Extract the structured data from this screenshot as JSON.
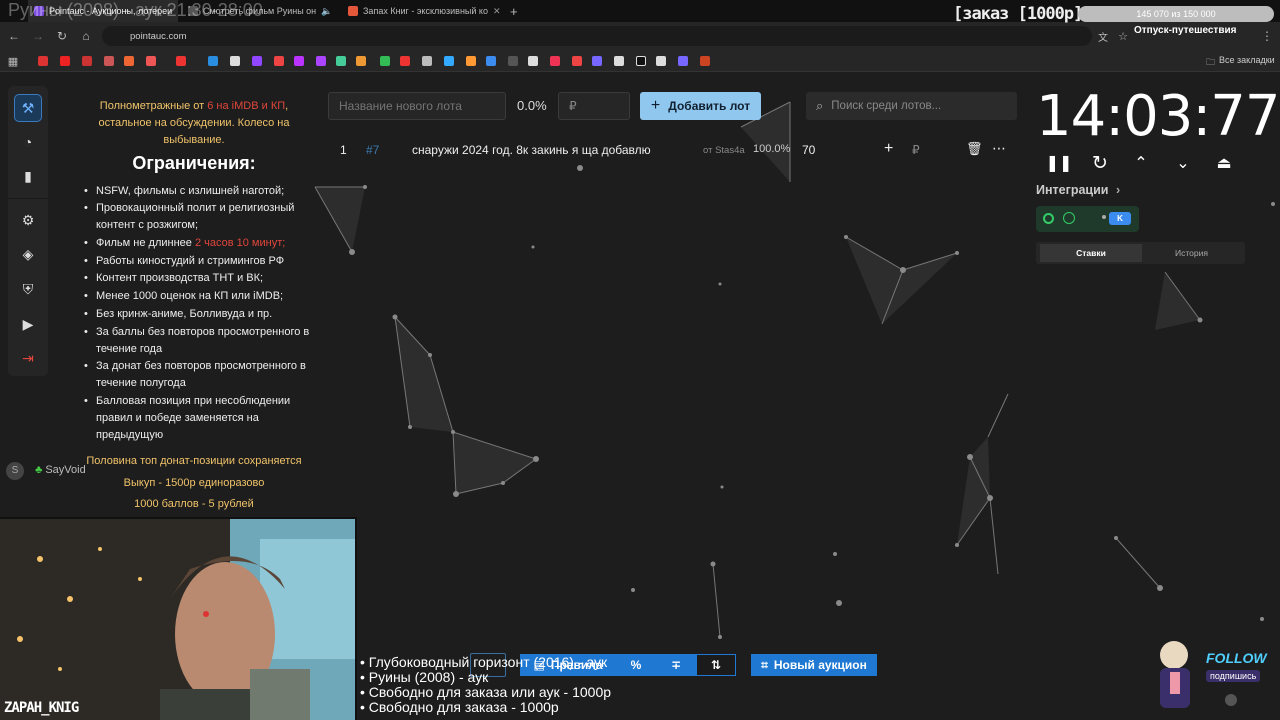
{
  "overlay": {
    "title": "Руины (2008) - аук 21:30-28:00",
    "order_text": "[заказ [1000р]",
    "goal_text": "145 070 из 150 000",
    "goal_name": "Отпуск-путешествия"
  },
  "browser": {
    "tabs": [
      {
        "label": "Pointauc - Аукционы, лотереи",
        "favicon_color": "#7b4be0"
      },
      {
        "label": "Смотреть фильм Руины он",
        "favicon_color": "#555555"
      },
      {
        "label": "Запах Книг - эксклюзивный ко",
        "favicon_color": "#e5573b"
      }
    ],
    "url": "pointauc.com",
    "all_bookmarks": "Все закладки"
  },
  "rules": {
    "intro_line1_a": "Полнометражные от ",
    "intro_line1_b": "6 на iMDB и КП",
    "intro_line1_c": ",",
    "intro_line2": "остальное на обсуждении. Колесо на",
    "intro_line3": "выбывание.",
    "heading": "Ограничения:",
    "items": [
      "NSFW, фильмы с излишней наготой;",
      "Провокационный полит и религиозный контент с розжигом;",
      "Фильм не длиннее ",
      "Работы киностудий и стримингов РФ",
      "Контент производства ТНТ и ВК;",
      "Менее 1000 оценок на КП или iMDB;",
      "Без кринж-аниме, Болливуда и пр.",
      "За баллы без повторов просмотренного в течение года",
      "За донат без повторов просмотренного в течение полугода",
      "Балловая позиция при несоблюдении правил и победе заменяется на предыдущую"
    ],
    "item3_red": "2 часов 10 минут;",
    "footer1": "Половина топ донат-позиции сохраняется",
    "footer2": "Выкуп - 1500р единоразово",
    "footer3": "1000 баллов - 5 рублей",
    "sayvoid": "SayVoid"
  },
  "lot_form": {
    "name_placeholder": "Название нового лота",
    "percent": "0.0%",
    "amount_placeholder": "₽",
    "add_button": "Добавить лот",
    "search_placeholder": "Поиск среди лотов..."
  },
  "lots": [
    {
      "index": "1",
      "id": "#7",
      "name": "снаружи 2024 год. 8к закинь я ща добавлю",
      "author": "от Stas4a",
      "percent": "100.0%",
      "amount": "70",
      "currency": "₽"
    }
  ],
  "timer": {
    "value": "14:03:77"
  },
  "integrations": {
    "label": "Интеграции",
    "tabs": [
      "Ставки",
      "История"
    ]
  },
  "bottom_toolbar": {
    "rules_button": "Правила",
    "new_auction_button": "Новый аукцион"
  },
  "queue": [
    "• Глубоководный горизонт (2016) - аук",
    "• Руины (2008) - аук",
    "• Свободно для заказа или аук - 1000р",
    "• Свободно для заказа - 1000р"
  ],
  "webcam": {
    "username": "ZAPAH_KNIG"
  },
  "follow_widget": {
    "title": "FOLLOW",
    "subtitle": "подпишись"
  },
  "colors": {
    "accent_blue": "#90c7ee",
    "button_blue": "#1f78d1",
    "rules_yellow": "#f0c36a",
    "rules_red": "#e0463c",
    "background": "#1d1d1d"
  }
}
